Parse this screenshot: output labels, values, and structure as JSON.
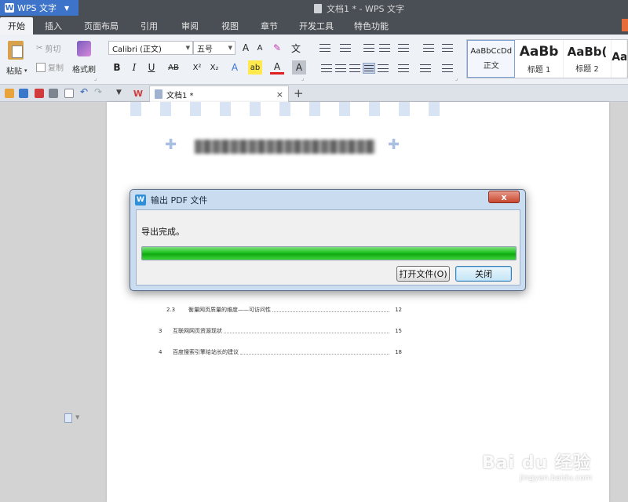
{
  "app": {
    "name": "WPS 文字",
    "window_title": "文档1 * - WPS 文字"
  },
  "menu": {
    "tabs": [
      {
        "label": "开始",
        "active": true
      },
      {
        "label": "插入"
      },
      {
        "label": "页面布局"
      },
      {
        "label": "引用"
      },
      {
        "label": "审阅"
      },
      {
        "label": "视图"
      },
      {
        "label": "章节"
      },
      {
        "label": "开发工具"
      },
      {
        "label": "特色功能"
      }
    ]
  },
  "ribbon": {
    "paste": "粘贴",
    "cut": "剪切",
    "copy": "复制",
    "format_painter": "格式刷",
    "font_name": "Calibri (正文)",
    "font_size": "五号",
    "grow_font": "A",
    "shrink_font": "A",
    "bold": "B",
    "italic": "I",
    "underline": "U",
    "strikethrough": "AB",
    "superscript": "X²",
    "subscript": "X₂",
    "text_effect": "A",
    "highlight": "ab",
    "font_color": "A",
    "char_shading": "A",
    "styles": [
      {
        "sample": "AaBbCcDd",
        "label": "正文"
      },
      {
        "sample": "AaBb",
        "label": "标题 1"
      },
      {
        "sample": "AaBb(",
        "label": "标题 2"
      },
      {
        "sample": "AaE",
        "label": ""
      }
    ]
  },
  "doc_tab": {
    "label": "文档1 *",
    "close": "×",
    "add": "+"
  },
  "document": {
    "toc": [
      {
        "num": "2.3",
        "text": "衡量网页质量的维度——可访问性",
        "page": "12"
      },
      {
        "num": "3",
        "text": "互联网网页资源现状",
        "page": "15"
      },
      {
        "num": "4",
        "text": "百度搜索引擎给站长的建议",
        "page": "18"
      }
    ]
  },
  "dialog": {
    "title": "输出 PDF 文件",
    "close": "x",
    "message": "导出完成。",
    "progress": 1.0,
    "open_button": "打开文件(O)",
    "close_button": "关闭"
  },
  "watermark": {
    "main": "Bai du 经验",
    "sub": "jingyan.baidu.com"
  }
}
